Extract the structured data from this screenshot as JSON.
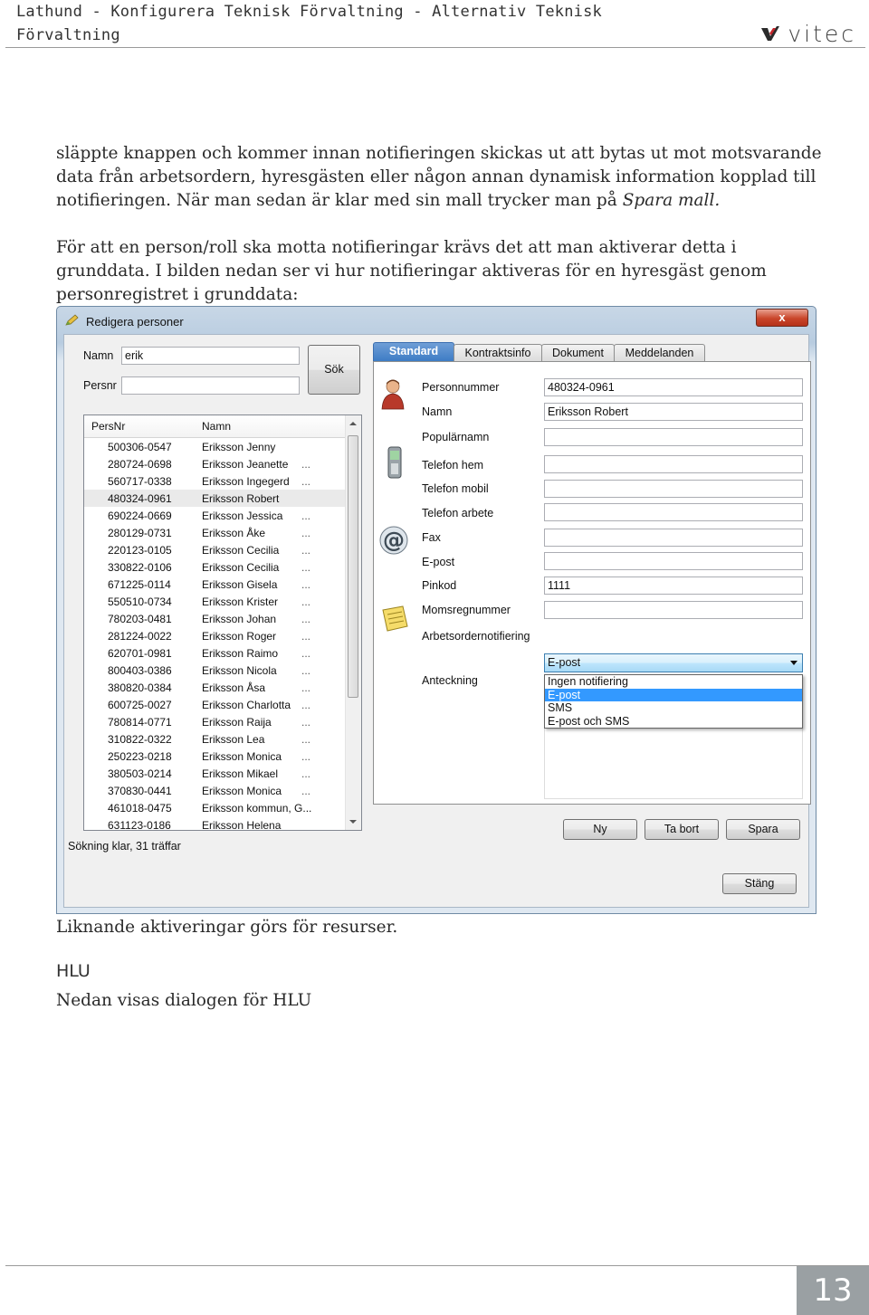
{
  "header": {
    "title": "Lathund - Konfigurera Teknisk Förvaltning - Alternativ Teknisk Förvaltning",
    "logo": "vitec"
  },
  "body": {
    "para1_a": "släppte knappen och kommer innan notifieringen skickas ut att bytas ut mot motsvarande data från arbetsordern, hyresgästen eller någon annan dynamisk information kopplad till notifieringen. När man sedan är klar med sin mall trycker man på ",
    "para1_em": "Spara mall.",
    "para2": "För att en person/roll ska motta notifieringar krävs det att man aktiverar detta i grunddata. I bilden nedan ser vi hur notifieringar aktiveras för en hyresgäst genom personregistret i grunddata:",
    "para3": "Liknande aktiveringar görs för resurser.",
    "heading_hlu": "HLU",
    "para4": "Nedan visas dialogen för HLU"
  },
  "page_number": "13",
  "window": {
    "title": "Redigera personer",
    "close": "x",
    "search": {
      "name_label": "Namn",
      "name_value": "erik",
      "persnr_label": "Persnr",
      "persnr_value": "",
      "button": "Sök"
    },
    "list": {
      "headers": [
        "PersNr",
        "Namn"
      ],
      "rows": [
        [
          "500306-0547",
          "Eriksson Jenny",
          ""
        ],
        [
          "280724-0698",
          "Eriksson Jeanette",
          "..."
        ],
        [
          "560717-0338",
          "Eriksson Ingegerd",
          "..."
        ],
        [
          "480324-0961",
          "Eriksson Robert",
          ""
        ],
        [
          "690224-0669",
          "Eriksson Jessica",
          "..."
        ],
        [
          "280129-0731",
          "Eriksson Åke",
          "..."
        ],
        [
          "220123-0105",
          "Eriksson Cecilia",
          "..."
        ],
        [
          "330822-0106",
          "Eriksson Cecilia",
          "..."
        ],
        [
          "671225-0114",
          "Eriksson Gisela",
          "..."
        ],
        [
          "550510-0734",
          "Eriksson Krister",
          "..."
        ],
        [
          "780203-0481",
          "Eriksson Johan",
          "..."
        ],
        [
          "281224-0022",
          "Eriksson Roger",
          "..."
        ],
        [
          "620701-0981",
          "Eriksson Raimo",
          "..."
        ],
        [
          "800403-0386",
          "Eriksson Nicola",
          "..."
        ],
        [
          "380820-0384",
          "Eriksson Åsa",
          "..."
        ],
        [
          "600725-0027",
          "Eriksson Charlotta",
          "..."
        ],
        [
          "780814-0771",
          "Eriksson Raija",
          "..."
        ],
        [
          "310822-0322",
          "Eriksson Lea",
          "..."
        ],
        [
          "250223-0218",
          "Eriksson Monica",
          "..."
        ],
        [
          "380503-0214",
          "Eriksson Mikael",
          "..."
        ],
        [
          "370830-0441",
          "Eriksson Monica",
          "..."
        ],
        [
          "461018-0475",
          "Eriksson kommun, G...",
          ""
        ],
        [
          "631123-0186",
          "Eriksson Helena",
          ""
        ]
      ]
    },
    "status": "Sökning klar, 31 träffar",
    "tabs": [
      "Standard",
      "Kontraktsinfo",
      "Dokument",
      "Meddelanden"
    ],
    "fields": {
      "personnummer_label": "Personnummer",
      "personnummer_value": "480324-0961",
      "namn_label": "Namn",
      "namn_value": "Eriksson Robert",
      "popularnamn_label": "Populärnamn",
      "telefon_hem_label": "Telefon hem",
      "telefon_mobil_label": "Telefon mobil",
      "telefon_arbete_label": "Telefon arbete",
      "fax_label": "Fax",
      "epost_label": "E-post",
      "pinkod_label": "Pinkod",
      "pinkod_value": "1111",
      "moms_label": "Momsregnummer",
      "ao_label": "Arbetsordernotifiering",
      "ao_value": "E-post",
      "ao_options": [
        "Ingen notifiering",
        "E-post",
        "SMS",
        "E-post och SMS"
      ],
      "anteckning_label": "Anteckning"
    },
    "buttons": {
      "ny": "Ny",
      "ta_bort": "Ta bort",
      "spara": "Spara",
      "stang": "Stäng"
    }
  }
}
